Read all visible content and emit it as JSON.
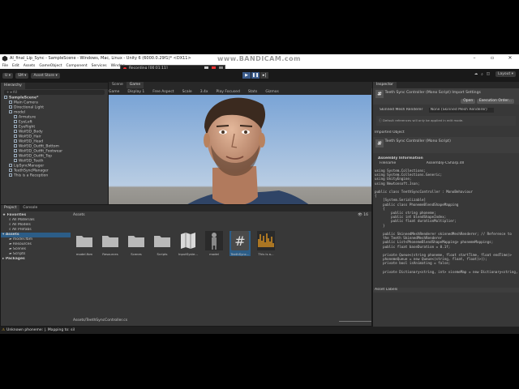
{
  "window": {
    "title": "AI_final_Lip_Sync - SampleScene - Windows, Mac, Linux - Unity 6 (6000.0.29f1)* <DX11>",
    "watermark": "www.BANDICAM.com"
  },
  "menu": [
    "File",
    "Edit",
    "Assets",
    "GameObject",
    "Component",
    "Services",
    "Window"
  ],
  "recording": {
    "label": "Recording [00:01:11]"
  },
  "toolbar": {
    "user": "U",
    "sm": "SM",
    "asset_store": "Asset Store",
    "layout": "Layout"
  },
  "hierarchy": {
    "tab": "Hierarchy",
    "search_placeholder": "All",
    "items": [
      {
        "label": "SampleScene*"
      },
      {
        "label": "Main Camera"
      },
      {
        "label": "Directional Light"
      },
      {
        "label": "model"
      },
      {
        "label": "Armature"
      },
      {
        "label": "EyeLeft"
      },
      {
        "label": "EyeRight"
      },
      {
        "label": "Wolf3D_Body"
      },
      {
        "label": "Wolf3D_Hair"
      },
      {
        "label": "Wolf3D_Head"
      },
      {
        "label": "Wolf3D_Outfit_Bottom"
      },
      {
        "label": "Wolf3D_Outfit_Footwear"
      },
      {
        "label": "Wolf3D_Outfit_Top"
      },
      {
        "label": "Wolf3D_Teeth"
      },
      {
        "label": "LipSyncManager"
      },
      {
        "label": "TeethSyncManager"
      },
      {
        "label": "This is a Reception"
      }
    ]
  },
  "scene_tabs": {
    "scene": "Scene",
    "game": "Game"
  },
  "game_bar": {
    "mode": "Game",
    "display": "Display 1",
    "aspect": "Free Aspect",
    "scale_label": "Scale",
    "scale_value": "3.4x",
    "play_focused": "Play Focused",
    "stats": "Stats",
    "gizmos": "Gizmos"
  },
  "inspector": {
    "tab": "Inspector",
    "header": "Teeth Sync Controller (Mono Script) Import Settings",
    "open": "Open",
    "exec_order": "Execution Order...",
    "skinned_label": "Skinned Mesh Renderer",
    "skinned_value": "None (Skinned Mesh Renderer)",
    "note": "Default references will only be applied in edit mode.",
    "imported_object": "Imported Object",
    "script_title": "Teeth Sync Controller (Mono Script)",
    "assembly_info": "Assembly Information",
    "filename_label": "Filename",
    "filename_value": "Assembly-CSharp.dll",
    "code": "using System.Collections;\nusing System.Collections.Generic;\nusing UnityEngine;\nusing Newtonsoft.Json;\n\npublic class TeethSyncController : MonoBehaviour\n{\n    [System.Serializable]\n    public class PhonemeBlendShapeMapping\n    {\n        public string phoneme;\n        public int blendShapeIndex;\n        public float durationMultiplier;\n    }\n\n    public SkinnedMeshRenderer skinnedMeshRenderer; // Reference to\n    the Teeth SkinnedMeshRenderer\n    public List<PhonemeBlendShapeMapping> phonemeMappings;\n    public float baseDuration = 0.1f;\n\n    private Queue<(string phoneme, float startTime, float endTime)>\n    phonemeQueue = new Queue<(string, float, float)>();\n    private bool isAnimating = false;\n\n    private Dictionary<string, int> visemeMap = new Dictionary<string,",
    "asset_labels": "Asset Labels"
  },
  "project": {
    "tab_project": "Project",
    "tab_console": "Console",
    "favorites": "Favorites",
    "fav_items": [
      "All Materials",
      "All Models",
      "All Prefabs"
    ],
    "assets": "Assets",
    "asset_tree": [
      "model.fbm",
      "Resources",
      "Scenes",
      "Scripts"
    ],
    "packages": "Packages",
    "breadcrumb": "Assets",
    "items": [
      {
        "label": "model.fbm",
        "kind": "folder"
      },
      {
        "label": "Resources",
        "kind": "folder"
      },
      {
        "label": "Scenes",
        "kind": "folder"
      },
      {
        "label": "Scripts",
        "kind": "folder"
      },
      {
        "label": "InputSyste...",
        "kind": "map"
      },
      {
        "label": "model",
        "kind": "model"
      },
      {
        "label": "TeethSync...",
        "kind": "script"
      },
      {
        "label": "This is a...",
        "kind": "audio"
      }
    ],
    "path": "Assets/TeethSyncController.cs",
    "item_count": "16"
  },
  "status": {
    "message": "Unknown phoneme: |. Mapping to: sil"
  },
  "colors": {
    "accent": "#3b5b8a",
    "panel": "#383838",
    "dark": "#191919"
  }
}
